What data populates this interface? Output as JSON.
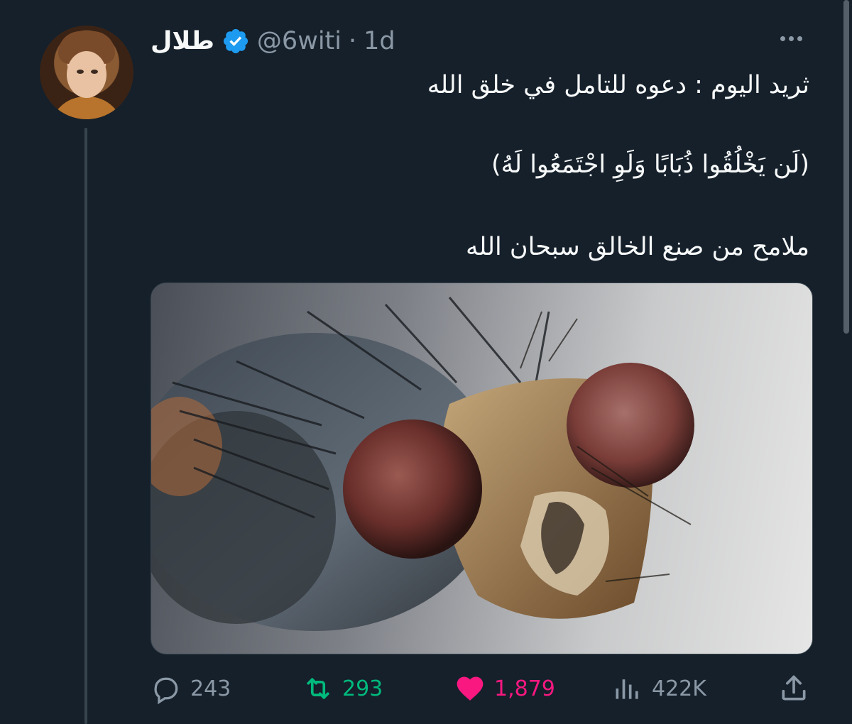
{
  "author": {
    "display_name": "طلال",
    "handle": "@6witi",
    "separator": "·",
    "time": "1d",
    "verified": true
  },
  "tweet": {
    "lines": [
      "ثريد اليوم : دعوه للتامل في خلق الله",
      "(لَن يَخْلُقُوا ذُبَابًا وَلَوِ اجْتَمَعُوا لَهُ)",
      "ملامح من صنع الخالق سبحان الله"
    ]
  },
  "actions": {
    "replies": "243",
    "retweets": "293",
    "likes": "1,879",
    "views": "422K"
  },
  "icons": {
    "more": "more-horizontal-icon",
    "reply": "reply-icon",
    "retweet": "retweet-icon",
    "like": "heart-icon",
    "views": "views-icon",
    "share": "share-icon",
    "verified": "verified-badge-icon"
  },
  "colors": {
    "background": "#15202b",
    "text": "#f7f9f9",
    "secondary": "#8b98a5",
    "verified": "#1d9bf0",
    "retweet": "#00ba7c",
    "like": "#f91880"
  }
}
